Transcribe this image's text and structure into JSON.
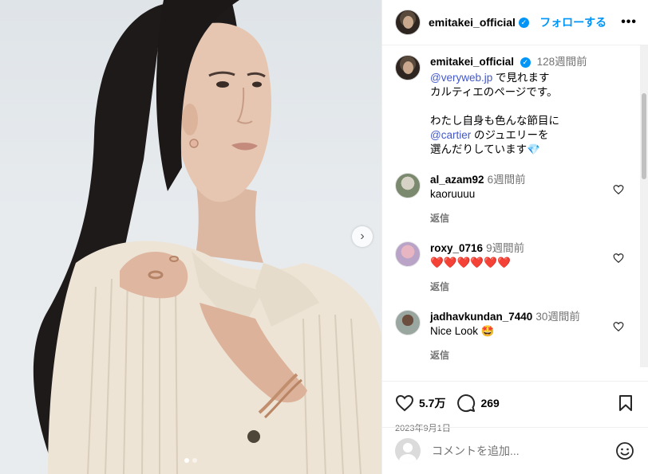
{
  "header": {
    "username": "emitakei_official",
    "follow_label": "フォローする",
    "more_label": "•••"
  },
  "caption": {
    "username": "emitakei_official",
    "time": "128週間前",
    "line1_mention": "@veryweb.jp",
    "line1_rest": " で見れます",
    "line2": "カルティエのページです。",
    "line3": "わたし自身も色んな節目に",
    "line4_mention": "@cartier",
    "line4_rest": " のジュエリーを",
    "line5": "選んだりしています💎"
  },
  "comments": [
    {
      "username": "al_azam92",
      "time": "6週間前",
      "text": "kaoruuuu",
      "reply": "返信"
    },
    {
      "username": "roxy_0716",
      "time": "9週間前",
      "text": "❤️❤️❤️❤️❤️❤️",
      "reply": "返信"
    },
    {
      "username": "jadhavkundan_7440",
      "time": "30週間前",
      "text": "Nice Look 🤩",
      "reply": "返信"
    }
  ],
  "actions": {
    "likes": "5.7万",
    "comments": "269",
    "date": "2023年9月1日"
  },
  "add_comment": {
    "placeholder": "コメントを追加..."
  },
  "carousel": {
    "next_label": "›",
    "slide_count": 2,
    "active_slide": 1
  },
  "colors": {
    "accent": "#0095f6",
    "muted": "#737373",
    "mention": "#4257c9"
  }
}
